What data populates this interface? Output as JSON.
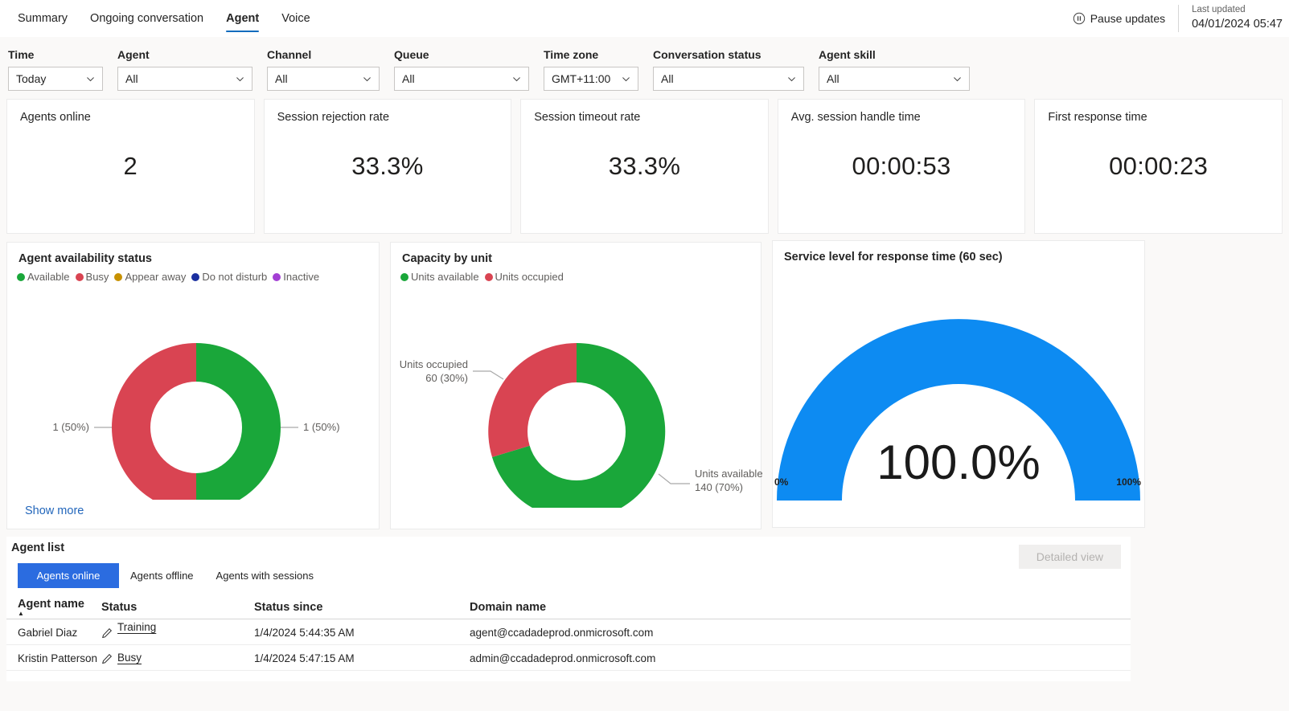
{
  "header": {
    "tabs": [
      {
        "label": "Summary",
        "active": false
      },
      {
        "label": "Ongoing conversation",
        "active": false
      },
      {
        "label": "Agent",
        "active": true
      },
      {
        "label": "Voice",
        "active": false
      }
    ],
    "pause_label": "Pause updates",
    "pause_icon": "pause-circle-icon",
    "last_updated_label": "Last updated",
    "last_updated_value": "04/01/2024 05:47"
  },
  "filters": [
    {
      "label": "Time",
      "value": "Today"
    },
    {
      "label": "Agent",
      "value": "All"
    },
    {
      "label": "Channel",
      "value": "All"
    },
    {
      "label": "Queue",
      "value": "All"
    },
    {
      "label": "Time zone",
      "value": "GMT+11:00"
    },
    {
      "label": "Conversation status",
      "value": "All"
    },
    {
      "label": "Agent skill",
      "value": "All"
    }
  ],
  "kpis": [
    {
      "title": "Agents online",
      "value": "2"
    },
    {
      "title": "Session rejection rate",
      "value": "33.3%"
    },
    {
      "title": "Session timeout rate",
      "value": "33.3%"
    },
    {
      "title": "Avg. session handle time",
      "value": "00:00:53"
    },
    {
      "title": "First response time",
      "value": "00:00:23"
    }
  ],
  "availability": {
    "title": "Agent availability status",
    "show_more": "Show more",
    "legend": [
      {
        "label": "Available",
        "color": "#1aa73a"
      },
      {
        "label": "Busy",
        "color": "#d94452"
      },
      {
        "label": "Appear away",
        "color": "#c79100"
      },
      {
        "label": "Do not disturb",
        "color": "#1b2fa0"
      },
      {
        "label": "Inactive",
        "color": "#a33fd4"
      }
    ],
    "labels": {
      "left": "1 (50%)",
      "right": "1 (50%)"
    }
  },
  "capacity": {
    "title": "Capacity by unit",
    "legend": [
      {
        "label": "Units available",
        "color": "#1aa73a"
      },
      {
        "label": "Units occupied",
        "color": "#d94452"
      }
    ],
    "callouts": {
      "occupied_l1": "Units occupied",
      "occupied_l2": "60 (30%)",
      "available_l1": "Units available",
      "available_l2": "140 (70%)"
    }
  },
  "gauge": {
    "title": "Service level for response time (60 sec)",
    "value_label": "100.0%",
    "min_label": "0%",
    "max_label": "100%",
    "color": "#0d8bf2"
  },
  "agent_list": {
    "title": "Agent list",
    "detailed_view_label": "Detailed view",
    "tabs": [
      {
        "label": "Agents online",
        "selected": true
      },
      {
        "label": "Agents offline",
        "selected": false
      },
      {
        "label": "Agents with sessions",
        "selected": false
      }
    ],
    "columns": [
      "Agent name",
      "Status",
      "Status since",
      "Domain name"
    ],
    "rows": [
      {
        "name": "Gabriel Diaz",
        "status": "Training",
        "since": "1/4/2024 5:44:35 AM",
        "domain": "agent@ccadadeprod.onmicrosoft.com"
      },
      {
        "name": "Kristin Patterson",
        "status": "Busy",
        "since": "1/4/2024 5:47:15 AM",
        "domain": "admin@ccadadeprod.onmicrosoft.com"
      }
    ]
  },
  "chart_data": [
    {
      "type": "pie",
      "title": "Agent availability status",
      "labels": [
        "Available",
        "Busy",
        "Appear away",
        "Do not disturb",
        "Inactive"
      ],
      "values": [
        1,
        1,
        0,
        0,
        0
      ],
      "percentages": [
        50,
        50,
        0,
        0,
        0
      ],
      "colors": [
        "#1aa73a",
        "#d94452",
        "#c79100",
        "#1b2fa0",
        "#a33fd4"
      ],
      "data_labels": [
        "1 (50%)",
        "1 (50%)"
      ],
      "legend": "top",
      "donut": true
    },
    {
      "type": "pie",
      "title": "Capacity by unit",
      "labels": [
        "Units available",
        "Units occupied"
      ],
      "values": [
        140,
        60
      ],
      "percentages": [
        70,
        30
      ],
      "colors": [
        "#1aa73a",
        "#d94452"
      ],
      "data_labels": [
        "Units available 140 (70%)",
        "Units occupied 60 (30%)"
      ],
      "legend": "top",
      "donut": true
    },
    {
      "type": "bar",
      "title": "Service level for response time (60 sec)",
      "categories": [
        "Service level"
      ],
      "values": [
        100.0
      ],
      "ylim": [
        0,
        100
      ],
      "ylabel": "%",
      "xlabel": "",
      "annotations": [
        "100.0%"
      ],
      "tick_labels": [
        "0%",
        "100%"
      ],
      "grid": false
    }
  ]
}
